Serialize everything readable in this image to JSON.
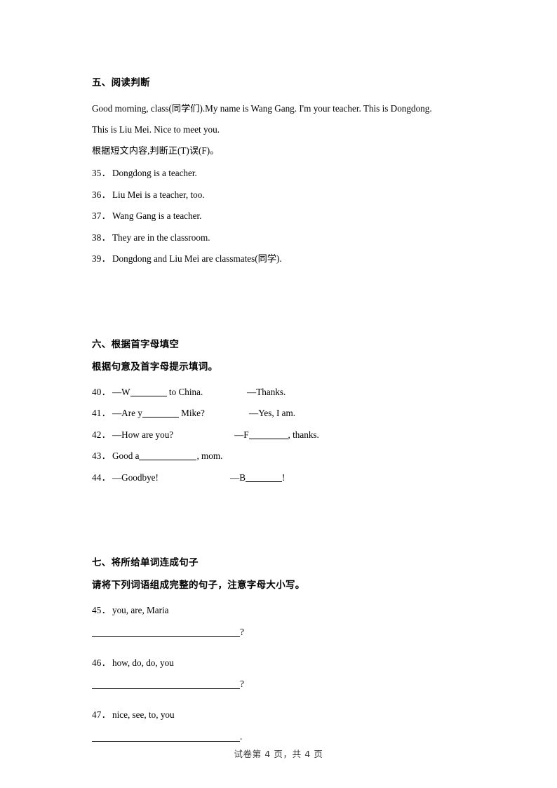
{
  "document": {
    "footer": "试卷第 4 页，共 4 页"
  },
  "sections": [
    {
      "heading": "五、阅读判断",
      "passage": [
        "Good morning, class(同学们).My name is Wang Gang. I'm your teacher. This is Dongdong.",
        "This is Liu Mei. Nice to meet you."
      ],
      "instruction": "根据短文内容,判断正(T)误(F)。",
      "items": [
        {
          "num": "35",
          "text": "Dongdong is a teacher."
        },
        {
          "num": "36",
          "text": "Liu Mei is a teacher, too."
        },
        {
          "num": "37",
          "text": "Wang Gang is a teacher."
        },
        {
          "num": "38",
          "text": "They are in the classroom."
        },
        {
          "num": "39",
          "text": "Dongdong and Liu Mei are classmates(同学)."
        }
      ]
    },
    {
      "heading": "六、根据首字母填空",
      "instruction": "根据句意及首字母提示填词。",
      "items": [
        {
          "num": "40",
          "left_before": "—W",
          "left_after": " to China.",
          "right": "—Thanks."
        },
        {
          "num": "41",
          "left_before": "—Are y",
          "left_after": " Mike?",
          "right": "—Yes, I am."
        },
        {
          "num": "42",
          "left_before": "—How are you?",
          "left_after": "",
          "right_before": "—F",
          "right_after": ", thanks."
        },
        {
          "num": "43",
          "left_before": "Good a",
          "left_after": ", mom.",
          "right": ""
        },
        {
          "num": "44",
          "left_before": "—Goodbye!",
          "left_after": "",
          "right_before": "—B",
          "right_after": "!"
        }
      ]
    },
    {
      "heading": "七、将所给单词连成句子",
      "instruction": "请将下列词语组成完整的句子，注意字母大小写。",
      "items": [
        {
          "num": "45",
          "words": "you, are, Maria",
          "terminator": "?"
        },
        {
          "num": "46",
          "words": "how, do, do, you",
          "terminator": "?"
        },
        {
          "num": "47",
          "words": "nice, see, to, you",
          "terminator": "."
        }
      ]
    }
  ]
}
